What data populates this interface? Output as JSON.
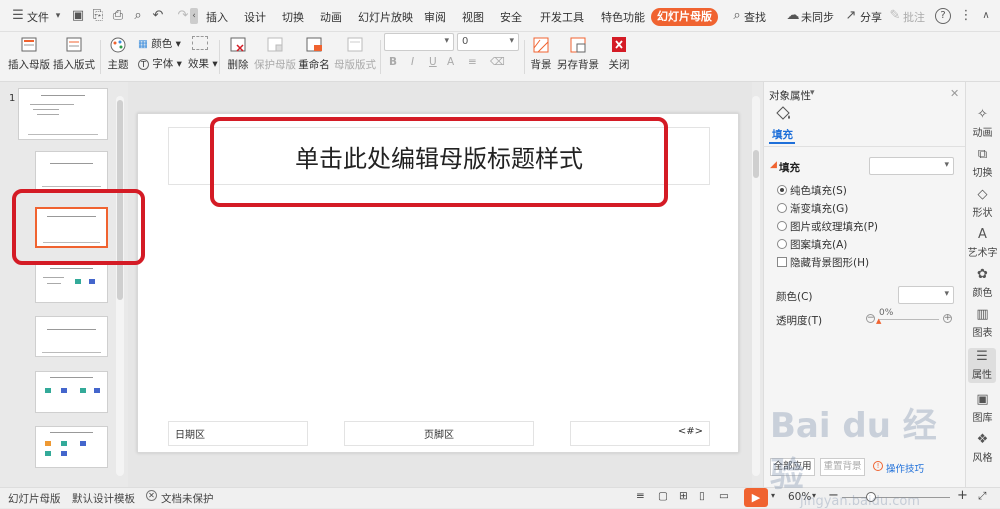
{
  "menubar": {
    "file": "文件",
    "tabs": [
      "插入",
      "设计",
      "切换",
      "动画",
      "幻灯片放映",
      "审阅",
      "视图",
      "安全",
      "开发工具",
      "特色功能"
    ],
    "active_tab": "幻灯片母版",
    "search": "查找",
    "sync": "未同步",
    "share": "分享",
    "comment": "批注",
    "help": "?"
  },
  "ribbon": {
    "insert_master": "插入母版",
    "insert_layout": "插入版式",
    "theme": "主题",
    "color": "颜色",
    "font": "字体",
    "effect": "效果",
    "delete": "删除",
    "protect_master": "保护母版",
    "rename": "重命名",
    "master_layout": "母版版式",
    "font_size": "0",
    "bold": "B",
    "italic": "I",
    "underline": "U",
    "font_color": "A",
    "background": "背景",
    "save_background": "另存背景",
    "close": "关闭"
  },
  "thumbs": {
    "number": "1"
  },
  "slide": {
    "title_placeholder": "单击此处编辑母版标题样式",
    "date_placeholder": "日期区",
    "footer_placeholder": "页脚区",
    "page_number": "<#>"
  },
  "props": {
    "header": "对象属性",
    "tab_fill": "填充",
    "section_fill": "填充",
    "options": [
      "纯色填充(S)",
      "渐变填充(G)",
      "图片或纹理填充(P)",
      "图案填充(A)"
    ],
    "hide_bg": "隐藏背景图形(H)",
    "color_label": "颜色(C)",
    "transparency_label": "透明度(T)",
    "transparency_value": "0%",
    "apply_all": "全部应用",
    "reset_bg": "重置背景",
    "tips": "操作技巧"
  },
  "rightbar": [
    "动画",
    "切换",
    "形状",
    "艺术字",
    "颜色",
    "图表",
    "属性",
    "图库",
    "风格"
  ],
  "status": {
    "view": "幻灯片母版",
    "template": "默认设计模板",
    "protect": "文档未保护",
    "zoom": "60%"
  },
  "watermark": {
    "brand": "Bai du 经验",
    "url": "jingyan.baidu.com"
  },
  "colors": {
    "accent": "#f06330",
    "annotation": "#d41b25"
  }
}
